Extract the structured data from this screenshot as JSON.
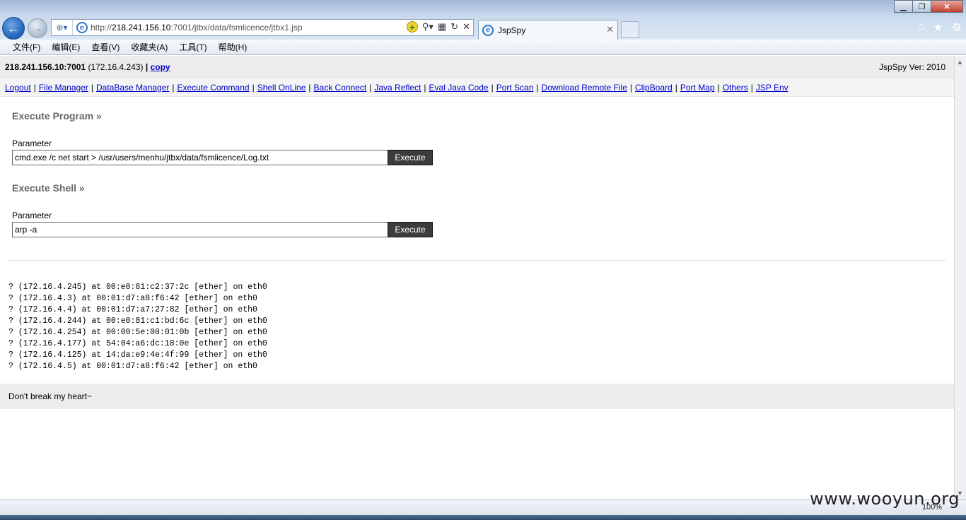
{
  "browser": {
    "url_prefix": "http://",
    "url_host": "218.241.156.10",
    "url_rest": ":7001/jtbx/data/fsmlicence/jtbx1.jsp",
    "tab_title": "JspSpy",
    "zoom": "100%"
  },
  "menubar": [
    "文件(F)",
    "编辑(E)",
    "查看(V)",
    "收藏夹(A)",
    "工具(T)",
    "帮助(H)"
  ],
  "header": {
    "host": "218.241.156.10:7001",
    "ip": "(172.16.4.243)",
    "separator": "|",
    "copy": "copy",
    "version": "JspSpy Ver: 2010"
  },
  "nav_links": [
    "Logout",
    "File Manager",
    "DataBase Manager",
    "Execute Command",
    "Shell OnLine",
    "Back Connect",
    "Java Reflect",
    "Eval Java Code",
    "Port Scan",
    "Download Remote File",
    "ClipBoard",
    "Port Map",
    "Others",
    "JSP Env"
  ],
  "execute_program": {
    "title": "Execute Program »",
    "param_label": "Parameter",
    "value": "cmd.exe /c net start > /usr/users/menhu/jtbx/data/fsmlicence/Log.txt",
    "button": "Execute"
  },
  "execute_shell": {
    "title": "Execute Shell »",
    "param_label": "Parameter",
    "value": "arp -a",
    "button": "Execute"
  },
  "output_lines": [
    "? (172.16.4.245) at 00:e0:81:c2:37:2c [ether] on eth0",
    "? (172.16.4.3) at 00:01:d7:a8:f6:42 [ether] on eth0",
    "? (172.16.4.4) at 00:01:d7:a7:27:82 [ether] on eth0",
    "? (172.16.4.244) at 00:e0:81:c1:bd:6c [ether] on eth0",
    "? (172.16.4.254) at 00:00:5e:00:01:0b [ether] on eth0",
    "? (172.16.4.177) at 54:04:a6:dc:18:0e [ether] on eth0",
    "? (172.16.4.125) at 14:da:e9:4e:4f:99 [ether] on eth0",
    "? (172.16.4.5) at 00:01:d7:a8:f6:42 [ether] on eth0"
  ],
  "footer": "Don't break my heart~",
  "watermark": "www.wooyun.org"
}
